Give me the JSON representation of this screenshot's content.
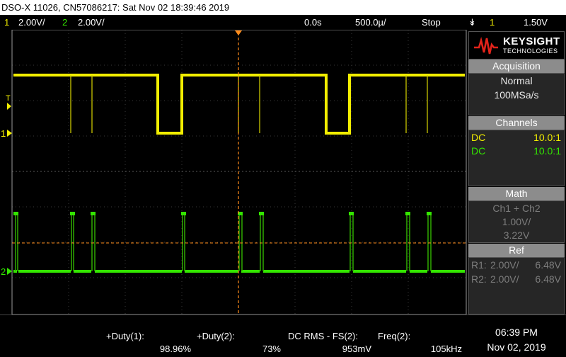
{
  "title_bar": "DSO-X 11026, CN57086217: Sat Nov 02 18:39:46 2019",
  "status": {
    "ch1_num": "1",
    "ch1_scale": "2.00V/",
    "ch2_num": "2",
    "ch2_scale": "2.00V/",
    "time_delay": "0.0s",
    "time_scale": "500.0µ/",
    "run_state": "Stop",
    "trigger_icon": "↡",
    "trigger_ch": "1",
    "trigger_level": "1.50V"
  },
  "logo": {
    "brand": "KEYSIGHT",
    "sub": "TECHNOLOGIES"
  },
  "acquisition": {
    "header": "Acquisition",
    "mode": "Normal",
    "rate": "100MSa/s"
  },
  "channels": {
    "header": "Channels",
    "rows": [
      {
        "coupling": "DC",
        "probe": "10.0:1"
      },
      {
        "coupling": "DC",
        "probe": "10.0:1"
      }
    ]
  },
  "math": {
    "header": "Math",
    "expr": "Ch1 + Ch2",
    "scale": "1.00V/",
    "offset": "3.22V"
  },
  "ref": {
    "header": "Ref",
    "rows": [
      {
        "label": "R1:",
        "scale": "2.00V/",
        "offset": "6.48V"
      },
      {
        "label": "R2:",
        "scale": "2.00V/",
        "offset": "6.48V"
      }
    ]
  },
  "measurements": [
    {
      "label": "+Duty(1):",
      "value": "98.96%"
    },
    {
      "label": "+Duty(2):",
      "value": "73%"
    },
    {
      "label": "DC RMS - FS(2):",
      "value": "953mV"
    },
    {
      "label": "Freq(2):",
      "value": "105kHz"
    }
  ],
  "datetime": {
    "time": "06:39 PM",
    "date": "Nov 02, 2019"
  },
  "markers": {
    "trigger_label": "T",
    "ch1_ground": "1",
    "ch2_ground": "2"
  },
  "colors": {
    "ch1": "#f2ee00",
    "ch2": "#33e500",
    "cursor": "#ff8c1a"
  }
}
